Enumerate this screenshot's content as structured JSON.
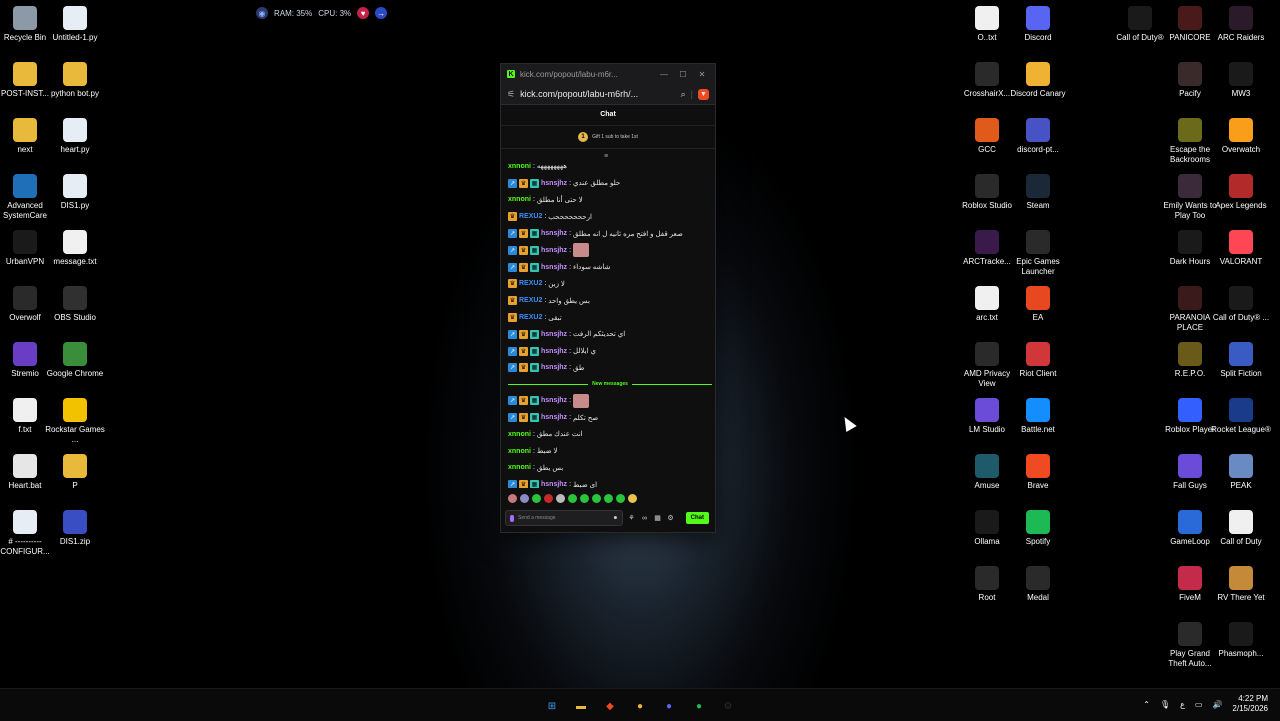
{
  "sysbar": {
    "ram": "RAM: 35%",
    "cpu": "CPU: 3%"
  },
  "desktop_left": [
    {
      "label": "Recycle Bin",
      "icon": "recycle-bin-icon",
      "color": "#8c9aa8"
    },
    {
      "label": "Untitled-1.py",
      "icon": "python-file-icon",
      "color": "#e6edf4"
    },
    {
      "label": "POST-INST...",
      "icon": "folder-icon",
      "color": "#e8b93a"
    },
    {
      "label": "python bot.py",
      "icon": "folder-icon",
      "color": "#e8b93a"
    },
    {
      "label": "next",
      "icon": "folder-icon",
      "color": "#e8b93a"
    },
    {
      "label": "heart.py",
      "icon": "python-file-icon",
      "color": "#e6edf4"
    },
    {
      "label": "Advanced SystemCare",
      "icon": "systemcare-icon",
      "color": "#1f6fb8"
    },
    {
      "label": "DIS1.py",
      "icon": "python-file-icon",
      "color": "#e6edf4"
    },
    {
      "label": "UrbanVPN",
      "icon": "vpn-icon",
      "color": "#1a1a1a"
    },
    {
      "label": "message.txt",
      "icon": "text-file-icon",
      "color": "#f0f0f0"
    },
    {
      "label": "Overwolf",
      "icon": "overwolf-icon",
      "color": "#2a2a2a"
    },
    {
      "label": "OBS Studio",
      "icon": "obs-icon",
      "color": "#303030"
    },
    {
      "label": "Stremio",
      "icon": "stremio-icon",
      "color": "#6a3ec4"
    },
    {
      "label": "Google Chrome",
      "icon": "chrome-icon",
      "color": "#3a8d3a"
    },
    {
      "label": "f.txt",
      "icon": "text-file-icon",
      "color": "#f0f0f0"
    },
    {
      "label": "Rockstar Games ...",
      "icon": "rockstar-icon",
      "color": "#f2c200"
    },
    {
      "label": "Heart.bat",
      "icon": "bat-file-icon",
      "color": "#e6e6e6"
    },
    {
      "label": "P",
      "icon": "folder-icon",
      "color": "#e8b93a"
    },
    {
      "label": "# ---------- CONFIGUR...",
      "icon": "python-file-icon",
      "color": "#e6edf4"
    },
    {
      "label": "DIS1.zip",
      "icon": "zip-icon",
      "color": "#3a4ec4"
    }
  ],
  "desktop_right": [
    {
      "label": "O..txt",
      "icon": "text-file-icon",
      "color": "#f0f0f0"
    },
    {
      "label": "Discord",
      "icon": "discord-icon",
      "color": "#5865f2"
    },
    {
      "label": "CrosshairX...",
      "icon": "crosshair-icon",
      "color": "#2a2a2a"
    },
    {
      "label": "Discord Canary",
      "icon": "discord-canary-icon",
      "color": "#f0b232"
    },
    {
      "label": "GCC",
      "icon": "gcc-icon",
      "color": "#e05a1c"
    },
    {
      "label": "discord-pt...",
      "icon": "discord-ptb-icon",
      "color": "#4752c4"
    },
    {
      "label": "Roblox Studio",
      "icon": "roblox-studio-icon",
      "color": "#2a2a2a"
    },
    {
      "label": "Steam",
      "icon": "steam-icon",
      "color": "#1b2838"
    },
    {
      "label": "ARCTracke...",
      "icon": "arctracker-icon",
      "color": "#3a1a4a"
    },
    {
      "label": "Epic Games Launcher",
      "icon": "epic-games-icon",
      "color": "#2a2a2a"
    },
    {
      "label": "arc.txt",
      "icon": "text-file-icon",
      "color": "#f0f0f0"
    },
    {
      "label": "EA",
      "icon": "ea-icon",
      "color": "#e8481f"
    },
    {
      "label": "AMD Privacy View",
      "icon": "amd-icon",
      "color": "#2a2a2a"
    },
    {
      "label": "Riot Client",
      "icon": "riot-icon",
      "color": "#d13639"
    },
    {
      "label": "LM Studio",
      "icon": "lm-studio-icon",
      "color": "#6a4cd8"
    },
    {
      "label": "Battle.net",
      "icon": "battlenet-icon",
      "color": "#148eff"
    },
    {
      "label": "Amuse",
      "icon": "amuse-icon",
      "color": "#1f5a6a"
    },
    {
      "label": "Brave",
      "icon": "brave-icon",
      "color": "#f04a23"
    },
    {
      "label": "Ollama",
      "icon": "ollama-icon",
      "color": "#1a1a1a"
    },
    {
      "label": "Spotify",
      "icon": "spotify-icon",
      "color": "#1db954"
    },
    {
      "label": "Root",
      "icon": "root-icon",
      "color": "#2a2a2a"
    },
    {
      "label": "Medal",
      "icon": "medal-icon",
      "color": "#2a2a2a"
    }
  ],
  "desktop_far_right": [
    {
      "label": "Call of Duty®",
      "icon": "call-of-duty-icon",
      "color": "#1a1a1a"
    },
    {
      "label": "PANICORE",
      "icon": "panicore-icon",
      "color": "#4a1a1a"
    },
    {
      "label": "ARC Raiders",
      "icon": "arc-raiders-icon",
      "color": "#2a1a2a"
    },
    {
      "label": "Pacify",
      "icon": "pacify-icon",
      "color": "#3a2a2a"
    },
    {
      "label": "MW3",
      "icon": "mw3-icon",
      "color": "#1a1a1a"
    },
    {
      "label": "Escape the Backrooms",
      "icon": "escape-backrooms-icon",
      "color": "#6a6a1a"
    },
    {
      "label": "Overwatch",
      "icon": "overwatch-icon",
      "color": "#f99e1a"
    },
    {
      "label": "Emily Wants to Play Too",
      "icon": "emily-icon",
      "color": "#3a2a3a"
    },
    {
      "label": "Apex Legends",
      "icon": "apex-icon",
      "color": "#b32a2a"
    },
    {
      "label": "Dark Hours",
      "icon": "dark-hours-icon",
      "color": "#1a1a1a"
    },
    {
      "label": "VALORANT",
      "icon": "valorant-icon",
      "color": "#ff4655"
    },
    {
      "label": "PARANOIA PLACE",
      "icon": "paranoia-icon",
      "color": "#3a1a1a"
    },
    {
      "label": "Call of Duty® ...",
      "icon": "call-of-duty-icon",
      "color": "#1a1a1a"
    },
    {
      "label": "R.E.P.O.",
      "icon": "repo-icon",
      "color": "#6a5a1a"
    },
    {
      "label": "Split Fiction",
      "icon": "split-fiction-icon",
      "color": "#3a5ac4"
    },
    {
      "label": "Roblox Player",
      "icon": "roblox-icon",
      "color": "#335fff"
    },
    {
      "label": "Rocket League®",
      "icon": "rocket-league-icon",
      "color": "#1a3a8a"
    },
    {
      "label": "Fall Guys",
      "icon": "fall-guys-icon",
      "color": "#6a4cd8"
    },
    {
      "label": "PEAK",
      "icon": "peak-icon",
      "color": "#6a8ac4"
    },
    {
      "label": "GameLoop",
      "icon": "gameloop-icon",
      "color": "#2a6ad8"
    },
    {
      "label": "Call of Duty",
      "icon": "text-file-icon",
      "color": "#f0f0f0"
    },
    {
      "label": "FiveM",
      "icon": "fivem-icon",
      "color": "#c42a4a"
    },
    {
      "label": "RV There Yet",
      "icon": "rv-icon",
      "color": "#c48a3a"
    },
    {
      "label": "Play Grand Theft Auto...",
      "icon": "gta-icon",
      "color": "#2a2a2a"
    },
    {
      "label": "Phasmoph...",
      "icon": "phasmophobia-icon",
      "color": "#1a1a1a"
    }
  ],
  "popup": {
    "title": "kick.com/popout/labu-m6r...",
    "url": "kick.com/popout/labu-m6rh/...",
    "chat_header": "Chat",
    "gift_text": "Gift 1 sub to take 1st",
    "new_messages": "New messages",
    "input_placeholder": "Send a message",
    "send_label": "Chat",
    "messages": [
      {
        "user": "xnnoni",
        "color": "#53fc18",
        "badges": [],
        "text": "ههههههههه"
      },
      {
        "user": "hsnsjhz",
        "color": "#c48fff",
        "badges": [
          "blue",
          "gold",
          "green"
        ],
        "text": "حلو مطلق عندي"
      },
      {
        "user": "xnnoni",
        "color": "#53fc18",
        "badges": [],
        "text": "لا حتى أنا مطلق"
      },
      {
        "user": "REXU2",
        "color": "#3b8df5",
        "badges": [
          "gold"
        ],
        "text": "ارحححححححب"
      },
      {
        "user": "hsnsjhz",
        "color": "#c48fff",
        "badges": [
          "blue",
          "gold",
          "green"
        ],
        "text": "صعر قفل و افتح مره ثانيه ل انه مطلق"
      },
      {
        "user": "hsnsjhz",
        "color": "#c48fff",
        "badges": [
          "blue",
          "gold",
          "green"
        ],
        "text": "",
        "image": true
      },
      {
        "user": "hsnsjhz",
        "color": "#c48fff",
        "badges": [
          "blue",
          "gold",
          "green"
        ],
        "text": "شاشه سوداء"
      },
      {
        "user": "REXU2",
        "color": "#3b8df5",
        "badges": [
          "gold"
        ],
        "text": "لا زين"
      },
      {
        "user": "REXU2",
        "color": "#3b8df5",
        "badges": [
          "gold"
        ],
        "text": "بس يطق واحد"
      },
      {
        "user": "REXU2",
        "color": "#3b8df5",
        "badges": [
          "gold"
        ],
        "text": "تبقى"
      },
      {
        "user": "hsnsjhz",
        "color": "#c48fff",
        "badges": [
          "blue",
          "gold",
          "green"
        ],
        "text": "اي تحديثكم الرفت"
      },
      {
        "user": "hsnsjhz",
        "color": "#c48fff",
        "badges": [
          "blue",
          "gold",
          "green"
        ],
        "text": "ي ايلالل"
      },
      {
        "user": "hsnsjhz",
        "color": "#c48fff",
        "badges": [
          "blue",
          "gold",
          "green"
        ],
        "text": "طق"
      }
    ],
    "new_messages_list": [
      {
        "user": "hsnsjhz",
        "color": "#c48fff",
        "badges": [
          "blue",
          "gold",
          "green"
        ],
        "text": "",
        "image": true
      },
      {
        "user": "hsnsjhz",
        "color": "#c48fff",
        "badges": [
          "blue",
          "gold",
          "green"
        ],
        "text": "صح تكلم"
      },
      {
        "user": "xnnoni",
        "color": "#53fc18",
        "badges": [],
        "text": "انت عندك مطق"
      },
      {
        "user": "xnnoni",
        "color": "#53fc18",
        "badges": [],
        "text": "لا ضبط"
      },
      {
        "user": "xnnoni",
        "color": "#53fc18",
        "badges": [],
        "text": "بس يطق"
      },
      {
        "user": "hsnsjhz",
        "color": "#c48fff",
        "badges": [
          "blue",
          "gold",
          "green"
        ],
        "text": "اي ضبط"
      }
    ]
  },
  "taskbar": {
    "time": "4:22 PM",
    "date": "2/15/2026",
    "lang": "ع",
    "items": [
      {
        "name": "start-icon",
        "color": "#3a9ef5",
        "glyph": "⊞"
      },
      {
        "name": "file-explorer-icon",
        "color": "#e8b93a",
        "glyph": "▬"
      },
      {
        "name": "brave-icon",
        "color": "#f04a23",
        "glyph": "◆"
      },
      {
        "name": "discord-canary-icon",
        "color": "#f0b232",
        "glyph": "●"
      },
      {
        "name": "discord-icon",
        "color": "#5865f2",
        "glyph": "●"
      },
      {
        "name": "spotify-icon",
        "color": "#1db954",
        "glyph": "●"
      },
      {
        "name": "steam-icon",
        "color": "#2a2a2a",
        "glyph": "⚙"
      }
    ]
  }
}
